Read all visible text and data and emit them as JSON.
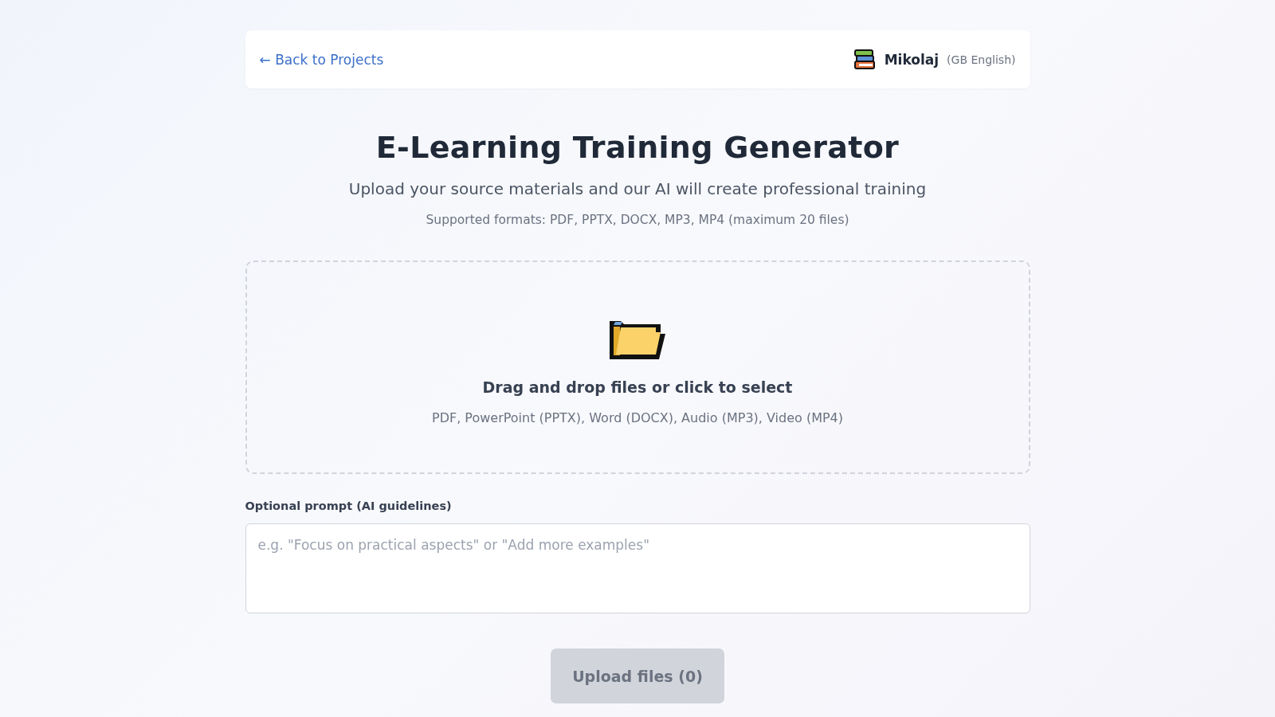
{
  "header": {
    "back_link": "← Back to Projects",
    "user": {
      "name": "Mikolaj",
      "language": "(GB English)"
    }
  },
  "title": "E-Learning Training Generator",
  "subtitle": "Upload your source materials and our AI will create professional training",
  "formats_note": "Supported formats: PDF, PPTX, DOCX, MP3, MP4 (maximum 20 files)",
  "dropzone": {
    "title": "Drag and drop files or click to select",
    "hint": "PDF, PowerPoint (PPTX), Word (DOCX), Audio (MP3), Video (MP4)"
  },
  "prompt": {
    "label": "Optional prompt (AI guidelines)",
    "placeholder": "e.g. \"Focus on practical aspects\" or \"Add more examples\""
  },
  "upload_button": {
    "label": "Upload files (0)",
    "disabled": true
  }
}
